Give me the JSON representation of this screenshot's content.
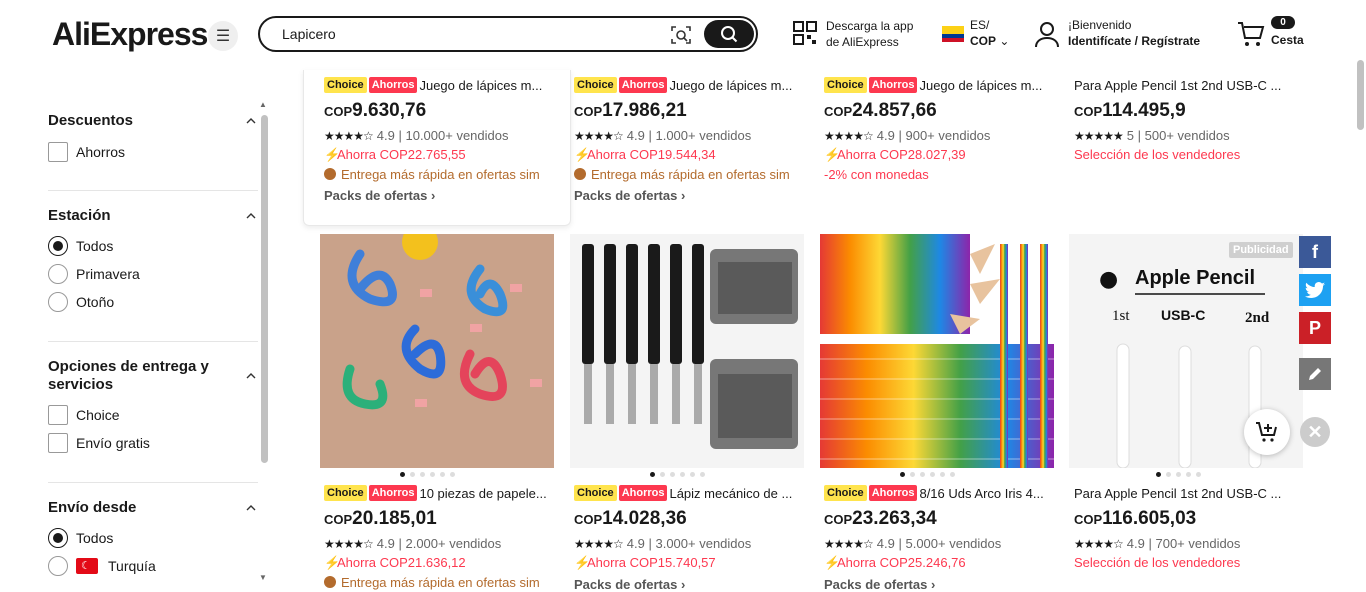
{
  "header": {
    "logo_text": "AliExpress",
    "search_value": "Lapicero",
    "app_line1": "Descarga la app",
    "app_line2": "de AliExpress",
    "lang": "ES/",
    "currency": "COP",
    "welcome": "¡Bienvenido",
    "signin": "Identifícate / Regístrate",
    "cart_count": "0",
    "cart_label": "Cesta"
  },
  "sidebar": {
    "descuentos": {
      "title": "Descuentos",
      "options": [
        "Ahorros"
      ]
    },
    "estacion": {
      "title": "Estación",
      "options": [
        "Todos",
        "Primavera",
        "Otoño"
      ],
      "selected": "Todos"
    },
    "entrega": {
      "title": "Opciones de entrega y servicios",
      "options": [
        "Choice",
        "Envío gratis"
      ]
    },
    "envio": {
      "title": "Envío desde",
      "options": [
        "Todos",
        "Turquía"
      ],
      "selected": "Todos"
    }
  },
  "badges": {
    "choice": "Choice",
    "ahorros": "Ahorros",
    "ad": "Publicidad"
  },
  "products_top": [
    {
      "title": "Juego de lápices m...",
      "cur": "COP",
      "price": "9.630,76",
      "rating": "4.9",
      "sold": "10.000+ vendidos",
      "save": "Ahorra COP22.765,55",
      "delivery": "Entrega más rápida en ofertas sim",
      "packs": "Packs de ofertas"
    },
    {
      "title": "Juego de lápices m...",
      "cur": "COP",
      "price": "17.986,21",
      "rating": "4.9",
      "sold": "1.000+ vendidos",
      "save": "Ahorra COP19.544,34",
      "delivery": "Entrega más rápida en ofertas sim",
      "packs": "Packs de ofertas"
    },
    {
      "title": "Juego de lápices m...",
      "cur": "COP",
      "price": "24.857,66",
      "rating": "4.9",
      "sold": "900+ vendidos",
      "save": "Ahorra COP28.027,39",
      "coins": "-2% con monedas"
    },
    {
      "title": "Para Apple Pencil 1st 2nd USB-C ...",
      "cur": "COP",
      "price": "114.495,9",
      "rating": "5",
      "sold": "500+ vendidos",
      "seller": "Selección de los vendedores"
    }
  ],
  "products_bottom": [
    {
      "title": "10 piezas de papele...",
      "cur": "COP",
      "price": "20.185,01",
      "rating": "4.9",
      "sold": "2.000+ vendidos",
      "save": "Ahorra COP21.636,12",
      "delivery": "Entrega más rápida en ofertas sim"
    },
    {
      "title": "Lápiz mecánico de ...",
      "cur": "COP",
      "price": "14.028,36",
      "rating": "4.9",
      "sold": "3.000+ vendidos",
      "save": "Ahorra COP15.740,57",
      "packs": "Packs de ofertas"
    },
    {
      "title": "8/16 Uds Arco Iris 4...",
      "cur": "COP",
      "price": "23.263,34",
      "rating": "4.9",
      "sold": "5.000+ vendidos",
      "save": "Ahorra COP25.246,76",
      "packs": "Packs de ofertas"
    },
    {
      "title": "Para Apple Pencil 1st 2nd USB-C ...",
      "cur": "COP",
      "price": "116.605,03",
      "rating": "4.9",
      "sold": "700+ vendidos",
      "seller": "Selección de los vendedores"
    }
  ],
  "apple_img": {
    "title": "Apple Pencil",
    "c1": "1st",
    "c2": "USB-C",
    "c3": "2nd"
  },
  "colors": {
    "accent": "#fd384f",
    "choice": "#ffe44d",
    "facebook": "#3b5998",
    "twitter": "#1da1f2",
    "pinterest": "#cb2027"
  }
}
